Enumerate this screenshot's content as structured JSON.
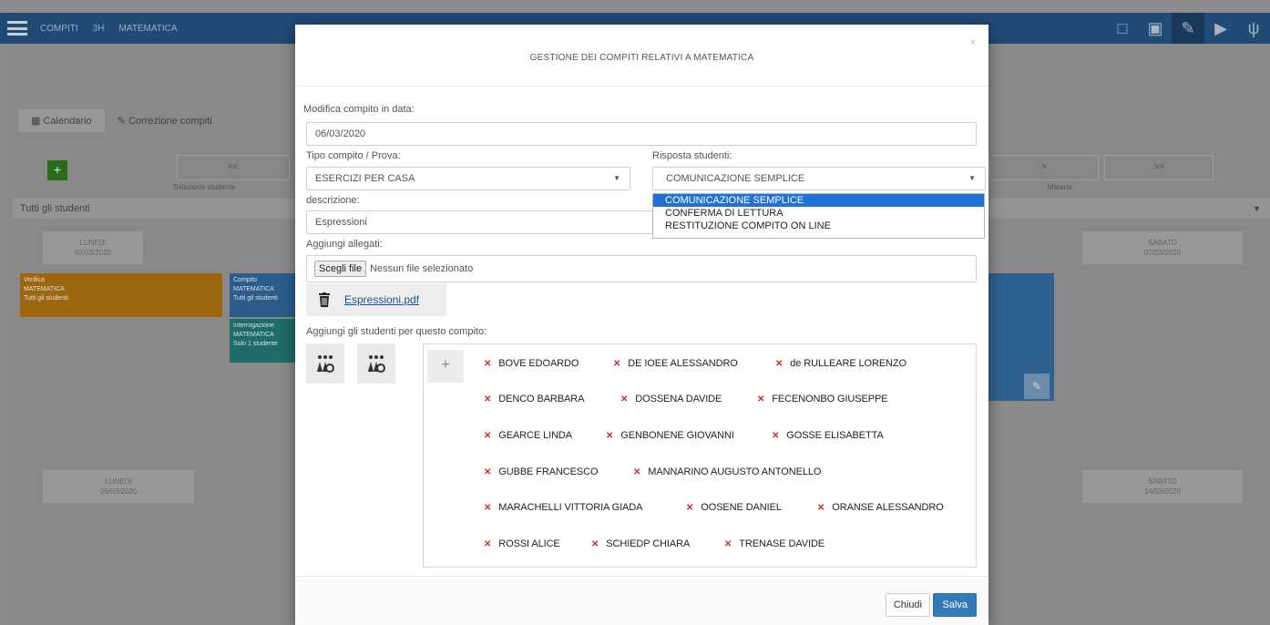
{
  "background": {
    "topnav": [
      "COMPITI",
      "3H",
      "MATEMATICA"
    ],
    "tabs": [
      "Calendario",
      "Correzione compiti"
    ],
    "nav_buttons": [
      "<<",
      ">",
      ">>"
    ],
    "selectors": [
      "Selezione studente",
      "Materia"
    ],
    "filter_value": "Tutti gli studenti",
    "day_headers": [
      {
        "day": "LUNEDI",
        "date": "02/03/2020"
      },
      {
        "day": "SABATO",
        "date": "07/03/2020"
      },
      {
        "day": "LUNEDI",
        "date": "09/03/2020"
      },
      {
        "day": "SABATO",
        "date": "14/03/2020"
      }
    ],
    "events": [
      {
        "lines": [
          "Verifica",
          "MATEMATICA",
          "Tutti gli studenti"
        ]
      },
      {
        "lines": [
          "Compito",
          "MATEMATICA",
          "Tutti gli studenti"
        ]
      },
      {
        "lines": [
          "Interrogazione",
          "MATEMATICA",
          "Solo 1 studente"
        ]
      }
    ]
  },
  "modal": {
    "title": "GESTIONE DEI COMPITI RELATIVI A MATEMATICA",
    "close_glyph": "×",
    "date_label": "Modifica compito in data:",
    "date_value": "06/03/2020",
    "type_label": "Tipo compito / Prova:",
    "type_value": "ESERCIZI PER CASA",
    "response_label": "Risposta studenti:",
    "response_value": "COMUNICAZIONE SEMPLICE",
    "response_options": [
      "COMUNICAZIONE SEMPLICE",
      "CONFERMA DI LETTURA",
      "RESTITUZIONE COMPITO ON LINE"
    ],
    "response_selected_index": 0,
    "description_label": "descrizione:",
    "description_value": "Espressioni",
    "attach_label": "Aggiungi allegati:",
    "file_button": "Scegli file",
    "file_status": "Nessun file selezionato",
    "attachment_name": "Espressioni.pdf",
    "students_label": "Aggiungi gli studenti per questo compito:",
    "plus_label": "+",
    "students": [
      [
        "BOVE EDOARDO",
        "DE IOEE ALESSANDRO",
        "de RULLEARE LORENZO"
      ],
      [
        "DENCO BARBARA",
        "DOSSENA DAVIDE",
        "FECENONBO GIUSEPPE"
      ],
      [
        "GEARCE LINDA",
        "GENBONENE GIOVANNI",
        "GOSSE ELISABETTA"
      ],
      [
        "GUBBE FRANCESCO",
        "MANNARINO AUGUSTO ANTONELLO"
      ],
      [
        "MARACHELLI VITTORIA GIADA",
        "OOSENE DANIEL",
        "ORANSE ALESSANDRO"
      ],
      [
        "ROSSI ALICE",
        "SCHIEDP CHIARA",
        "TRENASE DAVIDE"
      ]
    ],
    "footer": {
      "close": "Chiudi",
      "save": "Salva"
    }
  },
  "colors": {
    "topbar": "#224c78",
    "primary": "#337ab7",
    "selected_option": "#1e72d8",
    "remove_x": "#c9302c",
    "event_orange": "#a06a10",
    "event_teal": "#1f6f6a",
    "event_blue": "#2b5f8e"
  }
}
